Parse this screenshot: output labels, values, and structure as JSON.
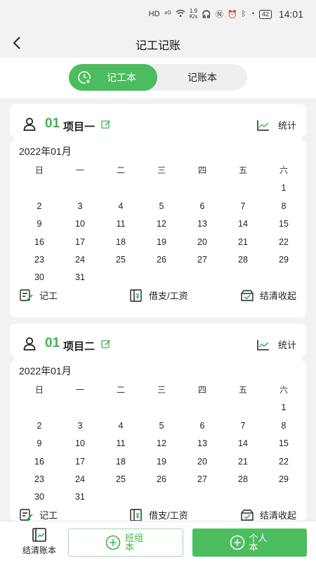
{
  "status_bar": {
    "hd": "HD",
    "signal": "⁴ᴳ",
    "speed_value": "1.9",
    "speed_unit": "K/s",
    "battery": "42",
    "time": "14:01"
  },
  "nav": {
    "title": "记工记账"
  },
  "segment": {
    "active_label": "记工本",
    "inactive_label": "记账本"
  },
  "calendar": {
    "weekdays": [
      "日",
      "一",
      "二",
      "三",
      "四",
      "五",
      "六"
    ]
  },
  "projects": [
    {
      "num": "01",
      "name": "项目一",
      "stats_label": "统计",
      "month": "2022年01月",
      "weeks": [
        [
          "",
          "",
          "",
          "",
          "",
          "",
          "1"
        ],
        [
          "2",
          "3",
          "4",
          "5",
          "6",
          "7",
          "8"
        ],
        [
          "9",
          "10",
          "11",
          "12",
          "13",
          "14",
          "15"
        ],
        [
          "16",
          "17",
          "18",
          "19",
          "20",
          "21",
          "22"
        ],
        [
          "23",
          "24",
          "25",
          "26",
          "27",
          "28",
          "29"
        ],
        [
          "30",
          "31",
          "",
          "",
          "",
          "",
          ""
        ]
      ],
      "actions": {
        "record": "记工",
        "loan": "借支/工资",
        "settle": "结清收起"
      }
    },
    {
      "num": "01",
      "name": "项目二",
      "stats_label": "统计",
      "month": "2022年01月",
      "weeks": [
        [
          "",
          "",
          "",
          "",
          "",
          "",
          "1"
        ],
        [
          "2",
          "3",
          "4",
          "5",
          "6",
          "7",
          "8"
        ],
        [
          "9",
          "10",
          "11",
          "12",
          "13",
          "14",
          "15"
        ],
        [
          "16",
          "17",
          "18",
          "19",
          "20",
          "21",
          "22"
        ],
        [
          "23",
          "24",
          "25",
          "26",
          "27",
          "28",
          "29"
        ],
        [
          "30",
          "31",
          "",
          "",
          "",
          "",
          ""
        ]
      ],
      "actions": {
        "record": "记工",
        "loan": "借支/工资",
        "settle": "结清收起"
      }
    }
  ],
  "bottom": {
    "ledger_label": "结清账本",
    "team_label": "班组本",
    "personal_label": "个人本"
  },
  "colors": {
    "accent": "#4cbd5f",
    "accent_text": "#3db54a",
    "background": "#f2f2f2"
  }
}
